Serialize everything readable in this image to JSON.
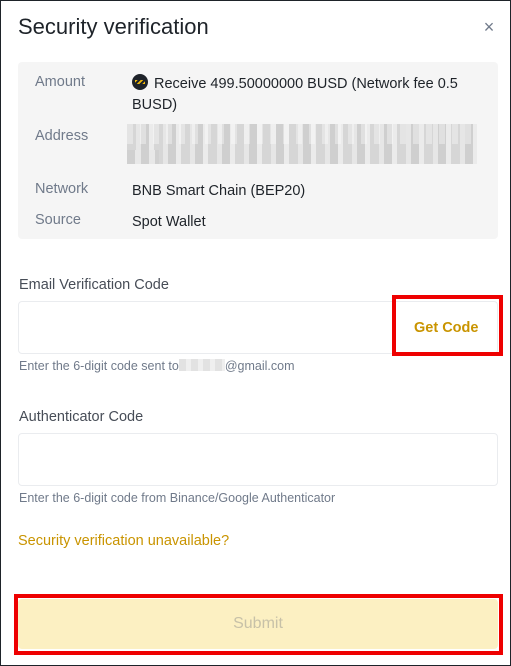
{
  "dialog": {
    "title": "Security verification",
    "close_icon": "close-icon",
    "close_glyph": "×"
  },
  "summary": {
    "amount_label": "Amount",
    "amount_value": "Receive 499.50000000 BUSD (Network fee 0.5 BUSD)",
    "coin_icon": "busd-coin-icon",
    "address_label": "Address",
    "network_label": "Network",
    "network_value": "BNB Smart Chain (BEP20)",
    "source_label": "Source",
    "source_value": "Spot Wallet"
  },
  "email": {
    "label": "Email Verification Code",
    "value": "",
    "get_code_label": "Get Code",
    "hint_prefix": "Enter the 6-digit code sent to",
    "hint_suffix": "@gmail.com"
  },
  "authenticator": {
    "label": "Authenticator Code",
    "value": "",
    "hint": "Enter the 6-digit code from Binance/Google Authenticator"
  },
  "links": {
    "unavailable": "Security verification unavailable?"
  },
  "actions": {
    "submit_label": "Submit"
  },
  "colors": {
    "accent": "#c99400",
    "submit_bg": "#fcf0c2",
    "highlight": "#ee0000"
  }
}
